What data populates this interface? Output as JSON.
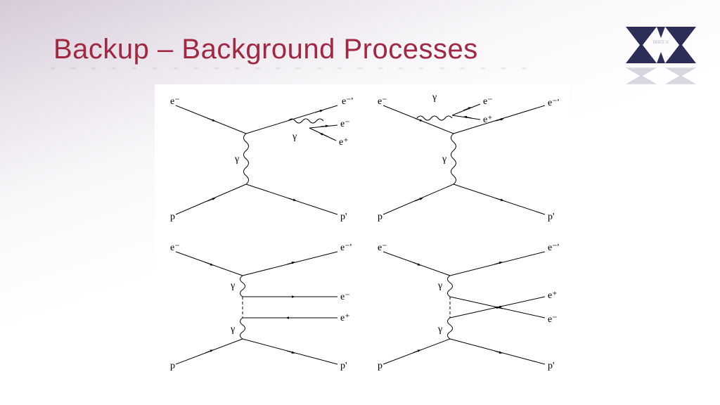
{
  "title": "Backup – Background Processes",
  "logo": {
    "text": "MAG X"
  },
  "diagrams": [
    {
      "name": "radiative-pair-photon-final",
      "incoming": [
        "e⁻",
        "p"
      ],
      "outgoing": [
        "e⁻'",
        "e⁻",
        "e⁺",
        "p'"
      ],
      "vertical_propagator": "γ",
      "extra_photon": "γ",
      "description": "e⁻p scattering via γ exchange; outgoing e⁻' radiates γ which converts to e⁻e⁺ pair"
    },
    {
      "name": "radiative-pair-photon-initial",
      "incoming": [
        "e⁻",
        "p"
      ],
      "outgoing": [
        "e⁻",
        "e⁺",
        "e⁻'",
        "p'"
      ],
      "vertical_propagator": "γ",
      "extra_photon": "γ",
      "description": "Incoming e⁻ radiates γ → e⁻e⁺ pair, then scatters via γ exchange → e⁻' p'"
    },
    {
      "name": "bethe-heitler-direct",
      "incoming": [
        "e⁻",
        "p"
      ],
      "outgoing": [
        "e⁻'",
        "e⁻",
        "e⁺",
        "p'"
      ],
      "propagators": [
        "γ",
        "γ"
      ],
      "description": "Two-photon (γγ) process producing e⁻e⁺ pair, direct topology"
    },
    {
      "name": "bethe-heitler-crossed",
      "incoming": [
        "e⁻",
        "p"
      ],
      "outgoing": [
        "e⁻'",
        "e⁺",
        "e⁻",
        "p'"
      ],
      "propagators": [
        "γ",
        "γ"
      ],
      "description": "Two-photon (γγ) process producing e⁻e⁺ pair, crossed topology"
    }
  ],
  "particle_labels": {
    "electron_in": "e⁻",
    "electron_out": "e⁻'",
    "electron": "e⁻",
    "positron": "e⁺",
    "proton_in": "p",
    "proton_out": "p'",
    "photon": "γ"
  }
}
